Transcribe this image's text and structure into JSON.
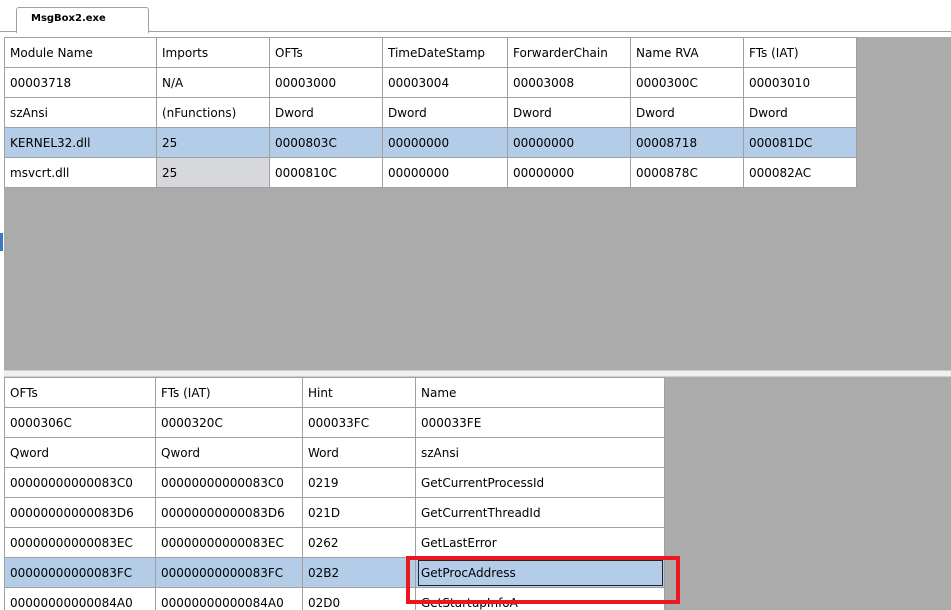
{
  "tab": {
    "label": "MsgBox2.exe"
  },
  "import_descriptors": {
    "headers": [
      "Module Name",
      "Imports",
      "OFTs",
      "TimeDateStamp",
      "ForwarderChain",
      "Name RVA",
      "FTs (IAT)"
    ],
    "offsets": [
      "00003718",
      "N/A",
      "00003000",
      "00003004",
      "00003008",
      "0000300C",
      "00003010"
    ],
    "types": [
      "szAnsi",
      "(nFunctions)",
      "Dword",
      "Dword",
      "Dword",
      "Dword",
      "Dword"
    ],
    "rows": [
      {
        "module": "KERNEL32.dll",
        "imports": "25",
        "ofts": "0000803C",
        "timedatestamp": "00000000",
        "forwarderchain": "00000000",
        "name_rva": "00008718",
        "fts": "000081DC",
        "selected": true
      },
      {
        "module": "msvcrt.dll",
        "imports": "25",
        "ofts": "0000810C",
        "timedatestamp": "00000000",
        "forwarderchain": "00000000",
        "name_rva": "0000878C",
        "fts": "000082AC",
        "selected": false
      }
    ]
  },
  "imported_functions": {
    "headers": [
      "OFTs",
      "FTs (IAT)",
      "Hint",
      "Name"
    ],
    "offsets": [
      "0000306C",
      "0000320C",
      "000033FC",
      "000033FE"
    ],
    "types": [
      "Qword",
      "Qword",
      "Word",
      "szAnsi"
    ],
    "rows": [
      {
        "ofts": "00000000000083C0",
        "fts": "00000000000083C0",
        "hint": "0219",
        "name": "GetCurrentProcessId",
        "selected": false
      },
      {
        "ofts": "00000000000083D6",
        "fts": "00000000000083D6",
        "hint": "021D",
        "name": "GetCurrentThreadId",
        "selected": false
      },
      {
        "ofts": "00000000000083EC",
        "fts": "00000000000083EC",
        "hint": "0262",
        "name": "GetLastError",
        "selected": false
      },
      {
        "ofts": "00000000000083FC",
        "fts": "00000000000083FC",
        "hint": "02B2",
        "name": "GetProcAddress",
        "selected": true
      },
      {
        "ofts": "00000000000084A0",
        "fts": "00000000000084A0",
        "hint": "02D0",
        "name": "GetStartupInfoA",
        "selected": false
      }
    ]
  },
  "colors": {
    "selection": "#b3cce8",
    "panel_bg": "#ababab",
    "highlight_box": "#e8181e"
  }
}
